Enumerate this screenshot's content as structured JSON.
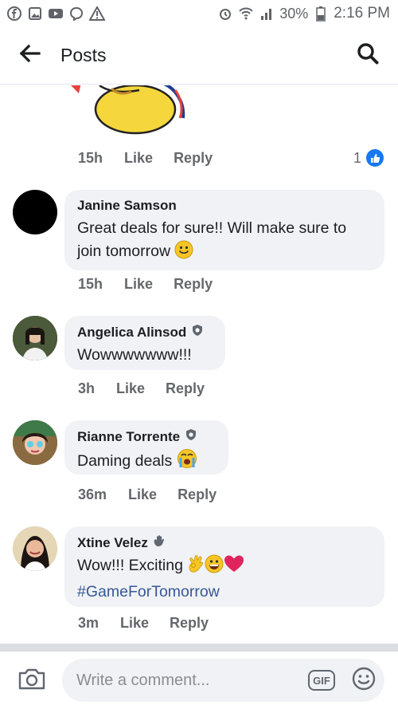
{
  "status_bar": {
    "battery": "30%",
    "time": "2:16 PM",
    "left_icons": [
      "facebook-icon",
      "gallery-icon",
      "youtube-icon",
      "viber-icon",
      "warning-icon"
    ],
    "right_icons": [
      "alarm-icon",
      "wifi-icon",
      "signal-icon",
      "battery-icon"
    ]
  },
  "header": {
    "title": "Posts",
    "back_icon": "back-arrow-icon",
    "search_icon": "search-icon"
  },
  "first_comment": {
    "time": "15h",
    "like": "Like",
    "reply": "Reply",
    "reaction_count": "1"
  },
  "comments": [
    {
      "name": "Janine Samson",
      "text": "Great deals for sure!! Will make sure to join tomorrow",
      "time": "15h",
      "like": "Like",
      "reply": "Reply"
    },
    {
      "name": "Angelica Alinsod",
      "text": "Wowwwwwww!!!",
      "time": "3h",
      "like": "Like",
      "reply": "Reply"
    },
    {
      "name": "Rianne Torrente",
      "text": "Daming deals",
      "time": "36m",
      "like": "Like",
      "reply": "Reply"
    },
    {
      "name": "Xtine Velez",
      "text": "Wow!!! Exciting",
      "hashtag": "#GameForTomorrow",
      "time": "3m",
      "like": "Like",
      "reply": "Reply"
    }
  ],
  "composer": {
    "placeholder": "Write a comment...",
    "gif_label": "GIF"
  },
  "colors": {
    "accent": "#1877f2",
    "bubble": "#f0f2f5",
    "meta": "#65676b",
    "hashtag": "#385898"
  }
}
